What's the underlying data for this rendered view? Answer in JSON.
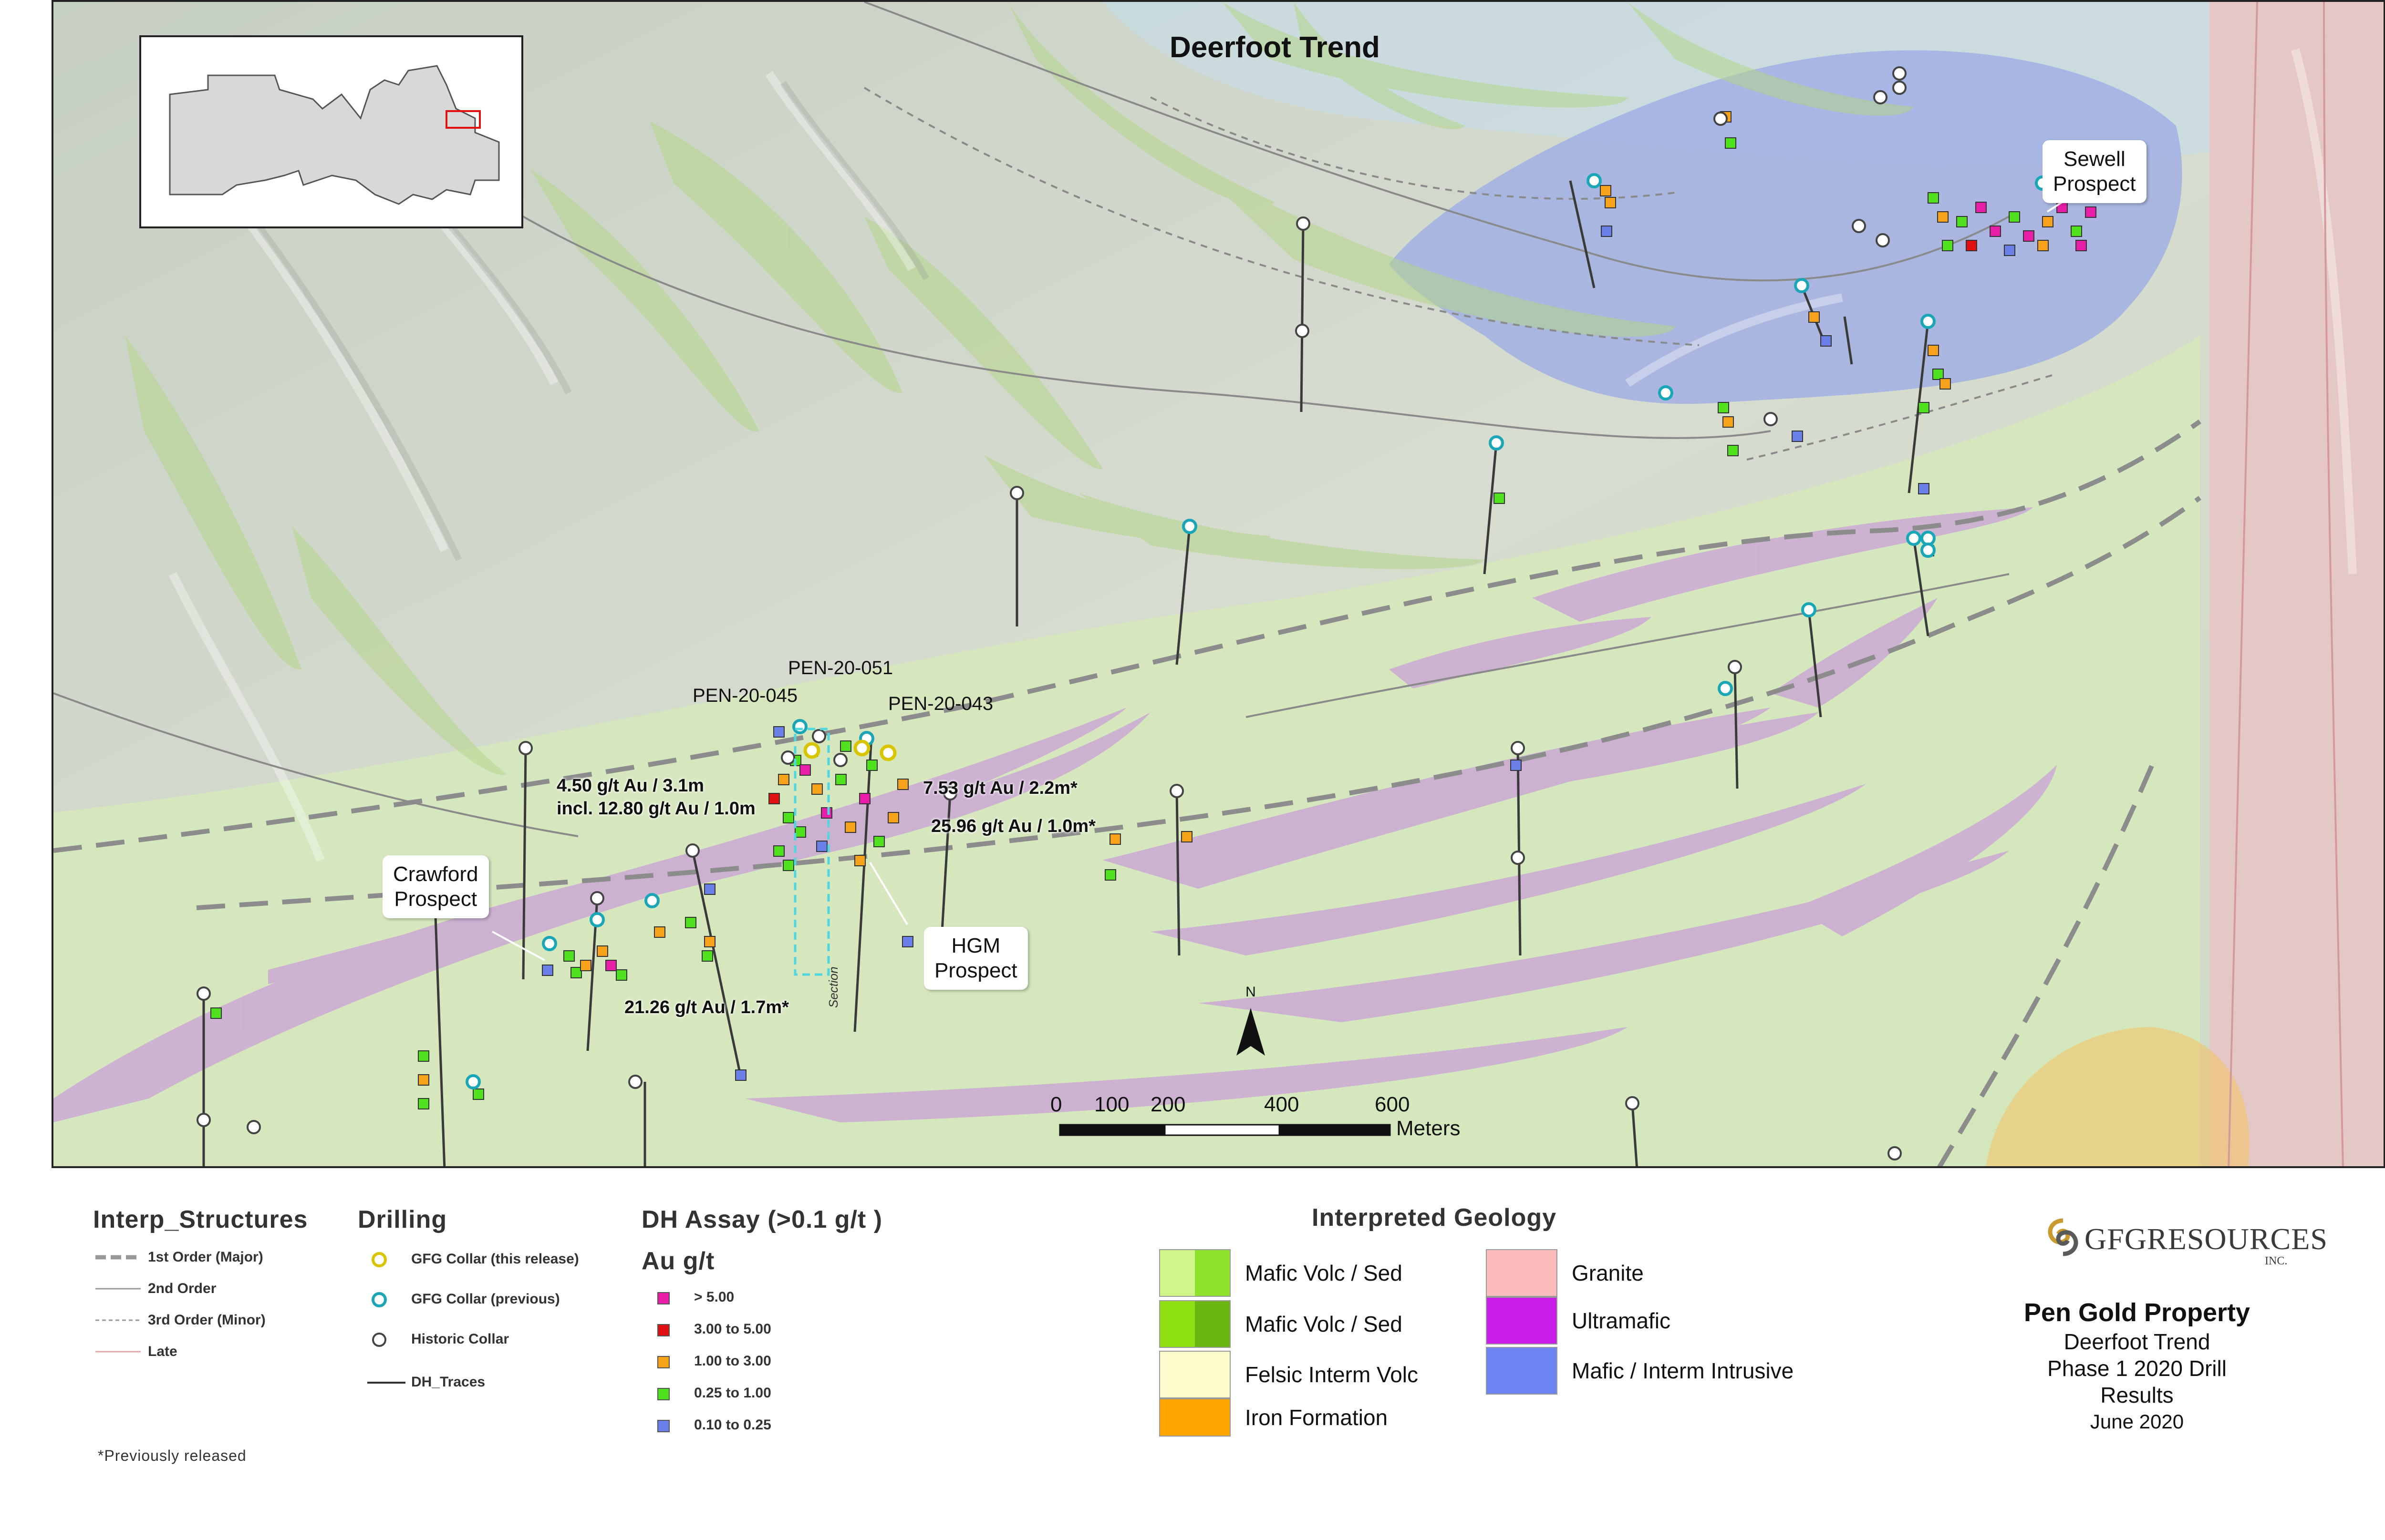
{
  "map": {
    "title": "Deerfoot Trend",
    "callouts": {
      "sewell": "Sewell\nProspect",
      "crawford": "Crawford\nProspect",
      "hgm": "HGM\nProspect"
    },
    "holes": {
      "pen051": "PEN-20-051",
      "pen045": "PEN-20-045",
      "pen043": "PEN-20-043"
    },
    "assays": {
      "a1_line1": "4.50 g/t Au / 3.1m",
      "a1_line2": "incl. 12.80 g/t Au / 1.0m",
      "a2": "7.53 g/t Au / 2.2m*",
      "a3": "25.96 g/t Au / 1.0m*",
      "a4": "21.26 g/t Au / 1.7m*"
    },
    "section_label": "Section",
    "north_label": "N",
    "scale": {
      "ticks": [
        "0",
        "100",
        "200",
        "400",
        "600"
      ],
      "units": "Meters"
    }
  },
  "legend": {
    "structures": {
      "title": "Interp_Structures",
      "items": [
        "1st Order (Major)",
        "2nd Order",
        "3rd Order (Minor)",
        "Late"
      ]
    },
    "drilling": {
      "title": "Drilling",
      "items": [
        "GFG Collar (this release)",
        "GFG Collar (previous)",
        "Historic Collar",
        "DH_Traces"
      ]
    },
    "assay": {
      "title": "DH Assay (>0.1 g/t )",
      "subtitle": "Au g/t",
      "items": [
        {
          "label": "> 5.00",
          "color": "#e81ea8"
        },
        {
          "label": "3.00 to 5.00",
          "color": "#e01010"
        },
        {
          "label": "1.00 to 3.00",
          "color": "#f7a21b"
        },
        {
          "label": "0.25 to 1.00",
          "color": "#4fe01e"
        },
        {
          "label": "0.10  to 0.25",
          "color": "#6a7fe8"
        }
      ]
    },
    "geology": {
      "title": "Interpreted Geology",
      "items": [
        {
          "label": "Mafic Volc / Sed",
          "colors": [
            "#d2f58a",
            "#8ee32a"
          ]
        },
        {
          "label": "Mafic Volc / Sed",
          "colors": [
            "#8fe010",
            "#6ab512"
          ]
        },
        {
          "label": "Felsic Interm Volc",
          "colors": [
            "#fbfbcb"
          ]
        },
        {
          "label": "Iron Formation",
          "colors": [
            "#ffa600"
          ]
        },
        {
          "label": "Granite",
          "colors": [
            "#fbbcbc"
          ]
        },
        {
          "label": "Ultramafic",
          "colors": [
            "#c81ee8"
          ]
        },
        {
          "label": "Mafic / Interm Intrusive",
          "colors": [
            "#6c84f2"
          ]
        }
      ]
    }
  },
  "footnote": "*Previously released",
  "brand": {
    "name": "GFGRESOURCES",
    "suffix": "INC."
  },
  "titleblock": {
    "property": "Pen Gold Property",
    "trend": "Deerfoot Trend",
    "phase": "Phase 1 2020 Drill Results",
    "date": "June 2020"
  }
}
